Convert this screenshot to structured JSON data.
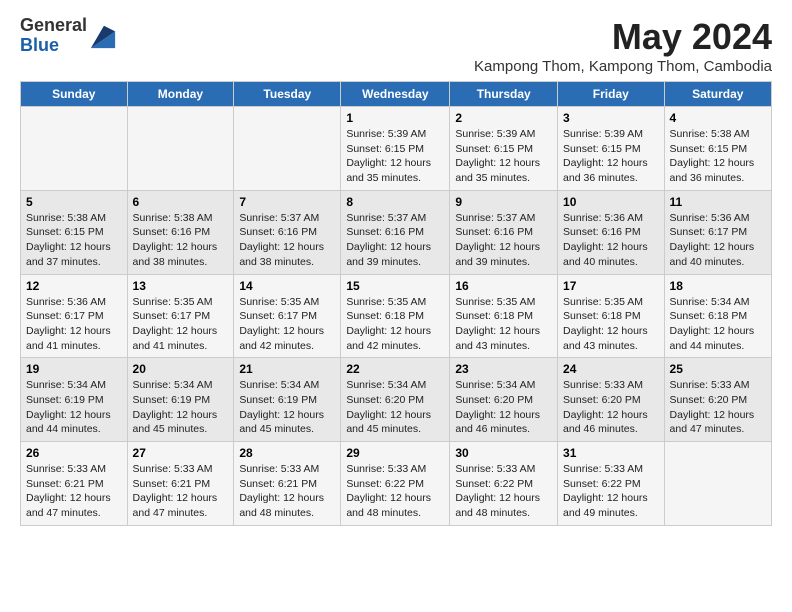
{
  "header": {
    "logo_general": "General",
    "logo_blue": "Blue",
    "month_title": "May 2024",
    "location": "Kampong Thom, Kampong Thom, Cambodia"
  },
  "days_of_week": [
    "Sunday",
    "Monday",
    "Tuesday",
    "Wednesday",
    "Thursday",
    "Friday",
    "Saturday"
  ],
  "weeks": [
    [
      {
        "day": "",
        "info": ""
      },
      {
        "day": "",
        "info": ""
      },
      {
        "day": "",
        "info": ""
      },
      {
        "day": "1",
        "info": "Sunrise: 5:39 AM\nSunset: 6:15 PM\nDaylight: 12 hours\nand 35 minutes."
      },
      {
        "day": "2",
        "info": "Sunrise: 5:39 AM\nSunset: 6:15 PM\nDaylight: 12 hours\nand 35 minutes."
      },
      {
        "day": "3",
        "info": "Sunrise: 5:39 AM\nSunset: 6:15 PM\nDaylight: 12 hours\nand 36 minutes."
      },
      {
        "day": "4",
        "info": "Sunrise: 5:38 AM\nSunset: 6:15 PM\nDaylight: 12 hours\nand 36 minutes."
      }
    ],
    [
      {
        "day": "5",
        "info": "Sunrise: 5:38 AM\nSunset: 6:15 PM\nDaylight: 12 hours\nand 37 minutes."
      },
      {
        "day": "6",
        "info": "Sunrise: 5:38 AM\nSunset: 6:16 PM\nDaylight: 12 hours\nand 38 minutes."
      },
      {
        "day": "7",
        "info": "Sunrise: 5:37 AM\nSunset: 6:16 PM\nDaylight: 12 hours\nand 38 minutes."
      },
      {
        "day": "8",
        "info": "Sunrise: 5:37 AM\nSunset: 6:16 PM\nDaylight: 12 hours\nand 39 minutes."
      },
      {
        "day": "9",
        "info": "Sunrise: 5:37 AM\nSunset: 6:16 PM\nDaylight: 12 hours\nand 39 minutes."
      },
      {
        "day": "10",
        "info": "Sunrise: 5:36 AM\nSunset: 6:16 PM\nDaylight: 12 hours\nand 40 minutes."
      },
      {
        "day": "11",
        "info": "Sunrise: 5:36 AM\nSunset: 6:17 PM\nDaylight: 12 hours\nand 40 minutes."
      }
    ],
    [
      {
        "day": "12",
        "info": "Sunrise: 5:36 AM\nSunset: 6:17 PM\nDaylight: 12 hours\nand 41 minutes."
      },
      {
        "day": "13",
        "info": "Sunrise: 5:35 AM\nSunset: 6:17 PM\nDaylight: 12 hours\nand 41 minutes."
      },
      {
        "day": "14",
        "info": "Sunrise: 5:35 AM\nSunset: 6:17 PM\nDaylight: 12 hours\nand 42 minutes."
      },
      {
        "day": "15",
        "info": "Sunrise: 5:35 AM\nSunset: 6:18 PM\nDaylight: 12 hours\nand 42 minutes."
      },
      {
        "day": "16",
        "info": "Sunrise: 5:35 AM\nSunset: 6:18 PM\nDaylight: 12 hours\nand 43 minutes."
      },
      {
        "day": "17",
        "info": "Sunrise: 5:35 AM\nSunset: 6:18 PM\nDaylight: 12 hours\nand 43 minutes."
      },
      {
        "day": "18",
        "info": "Sunrise: 5:34 AM\nSunset: 6:18 PM\nDaylight: 12 hours\nand 44 minutes."
      }
    ],
    [
      {
        "day": "19",
        "info": "Sunrise: 5:34 AM\nSunset: 6:19 PM\nDaylight: 12 hours\nand 44 minutes."
      },
      {
        "day": "20",
        "info": "Sunrise: 5:34 AM\nSunset: 6:19 PM\nDaylight: 12 hours\nand 45 minutes."
      },
      {
        "day": "21",
        "info": "Sunrise: 5:34 AM\nSunset: 6:19 PM\nDaylight: 12 hours\nand 45 minutes."
      },
      {
        "day": "22",
        "info": "Sunrise: 5:34 AM\nSunset: 6:20 PM\nDaylight: 12 hours\nand 45 minutes."
      },
      {
        "day": "23",
        "info": "Sunrise: 5:34 AM\nSunset: 6:20 PM\nDaylight: 12 hours\nand 46 minutes."
      },
      {
        "day": "24",
        "info": "Sunrise: 5:33 AM\nSunset: 6:20 PM\nDaylight: 12 hours\nand 46 minutes."
      },
      {
        "day": "25",
        "info": "Sunrise: 5:33 AM\nSunset: 6:20 PM\nDaylight: 12 hours\nand 47 minutes."
      }
    ],
    [
      {
        "day": "26",
        "info": "Sunrise: 5:33 AM\nSunset: 6:21 PM\nDaylight: 12 hours\nand 47 minutes."
      },
      {
        "day": "27",
        "info": "Sunrise: 5:33 AM\nSunset: 6:21 PM\nDaylight: 12 hours\nand 47 minutes."
      },
      {
        "day": "28",
        "info": "Sunrise: 5:33 AM\nSunset: 6:21 PM\nDaylight: 12 hours\nand 48 minutes."
      },
      {
        "day": "29",
        "info": "Sunrise: 5:33 AM\nSunset: 6:22 PM\nDaylight: 12 hours\nand 48 minutes."
      },
      {
        "day": "30",
        "info": "Sunrise: 5:33 AM\nSunset: 6:22 PM\nDaylight: 12 hours\nand 48 minutes."
      },
      {
        "day": "31",
        "info": "Sunrise: 5:33 AM\nSunset: 6:22 PM\nDaylight: 12 hours\nand 49 minutes."
      },
      {
        "day": "",
        "info": ""
      }
    ]
  ]
}
